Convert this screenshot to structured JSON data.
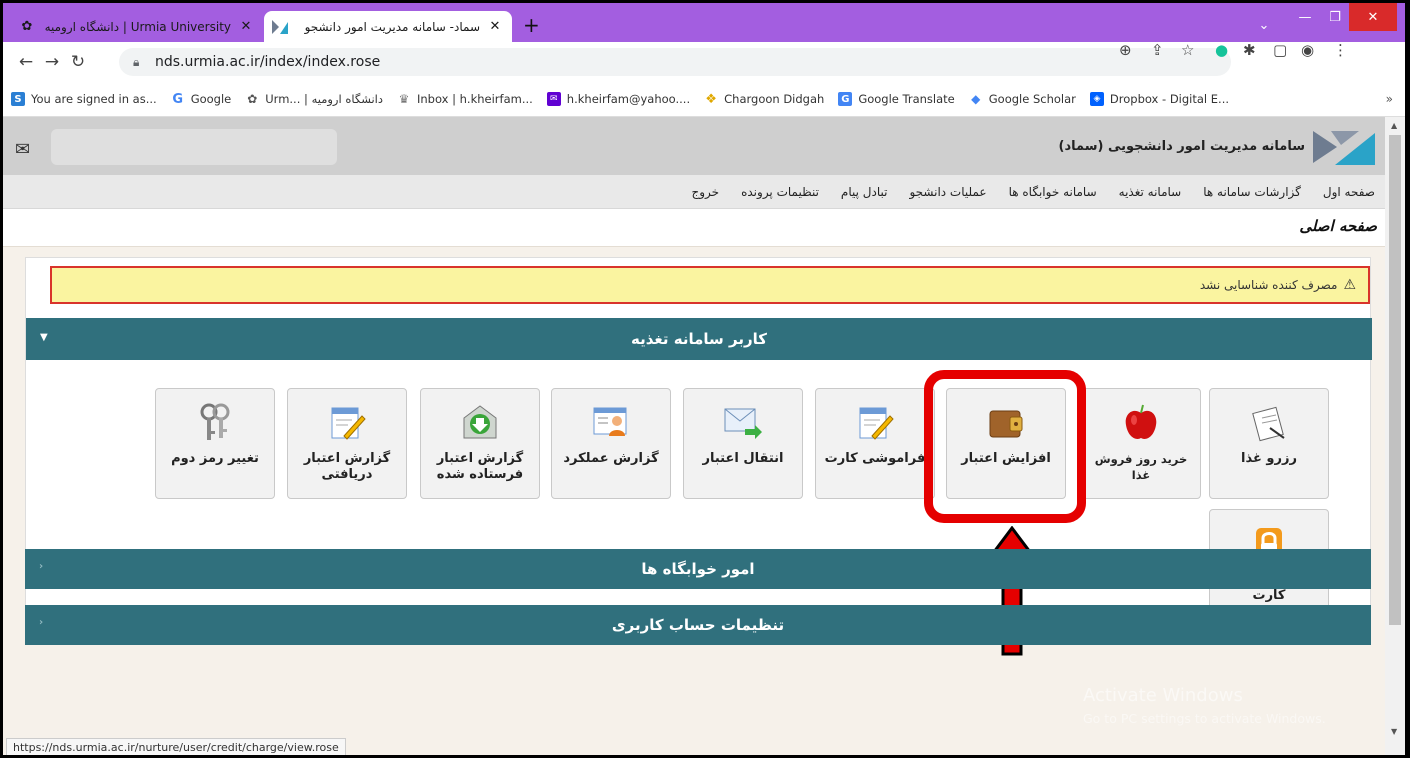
{
  "browser": {
    "tabs": [
      {
        "title": "Urmia University | دانشگاه ارومیه",
        "active": false
      },
      {
        "title": "سماد- سامانه مدیریت امور دانشجو",
        "active": true
      }
    ],
    "new_tab": "+",
    "url": "nds.urmia.ac.ir/index/index.rose",
    "bookmarks": [
      {
        "label": "You are signed in as...",
        "icon": "s-icon"
      },
      {
        "label": "Google",
        "icon": "google-icon"
      },
      {
        "label": "Urm... | دانشگاه ارومیه",
        "icon": "urmia-icon"
      },
      {
        "label": "Inbox | h.kheirfam...",
        "icon": "inbox-icon"
      },
      {
        "label": "h.kheirfam@yahoo....",
        "icon": "yahoo-mail-icon"
      },
      {
        "label": "Chargoon Didgah",
        "icon": "chargoon-icon"
      },
      {
        "label": "Google Translate",
        "icon": "translate-icon"
      },
      {
        "label": "Google Scholar",
        "icon": "scholar-icon"
      },
      {
        "label": "Dropbox - Digital E...",
        "icon": "dropbox-icon"
      }
    ],
    "status_url": "https://nds.urmia.ac.ir/nurture/user/credit/charge/view.rose"
  },
  "app": {
    "system_name": "سامانه مدیریت امور دانشجویی (سماد)",
    "menu": [
      "صفحه اول",
      "گزارشات سامانه ها",
      "سامانه تغذیه",
      "سامانه خوابگاه ها",
      "عملیات دانشجو",
      "تبادل پیام",
      "تنظیمات پرونده",
      "خروج"
    ],
    "page_title": "صفحه اصلی",
    "warning": "مصرف کننده شناسایی نشد",
    "section_food": "کاربر سامانه تغذیه",
    "tiles": [
      {
        "label": "رزرو غذا",
        "icon": "reserve-icon"
      },
      {
        "label": "خرید روز فروش غذا",
        "icon": "apple-icon"
      },
      {
        "label": "افزایش اعتبار",
        "icon": "wallet-icon"
      },
      {
        "label": "فراموشی کارت",
        "icon": "edit-note-icon"
      },
      {
        "label": "انتقال اعتبار",
        "icon": "envelope-arrow-icon"
      },
      {
        "label": "گزارش عملکرد",
        "icon": "report-person-icon"
      },
      {
        "label": "گزارش اعتبار فرستاده شده",
        "icon": "download-envelope-icon"
      },
      {
        "label": "گزارش اعتبار دریافتی",
        "icon": "edit-note-icon"
      },
      {
        "label": "تغییر رمز دوم",
        "icon": "keys-icon"
      },
      {
        "label": "قفل نمودن کارت",
        "icon": "lock-icon"
      }
    ],
    "section_dorm": "امور خوابگاه ها",
    "section_account": "تنظیمات حساب کاربری"
  },
  "watermark": {
    "line1": "Activate Windows",
    "line2": "Go to PC settings to activate Windows."
  },
  "colors": {
    "tabstrip": "#a35ee0",
    "section_bar": "#30707d",
    "highlight": "#e50000",
    "warning_bg": "#faf4a0"
  }
}
